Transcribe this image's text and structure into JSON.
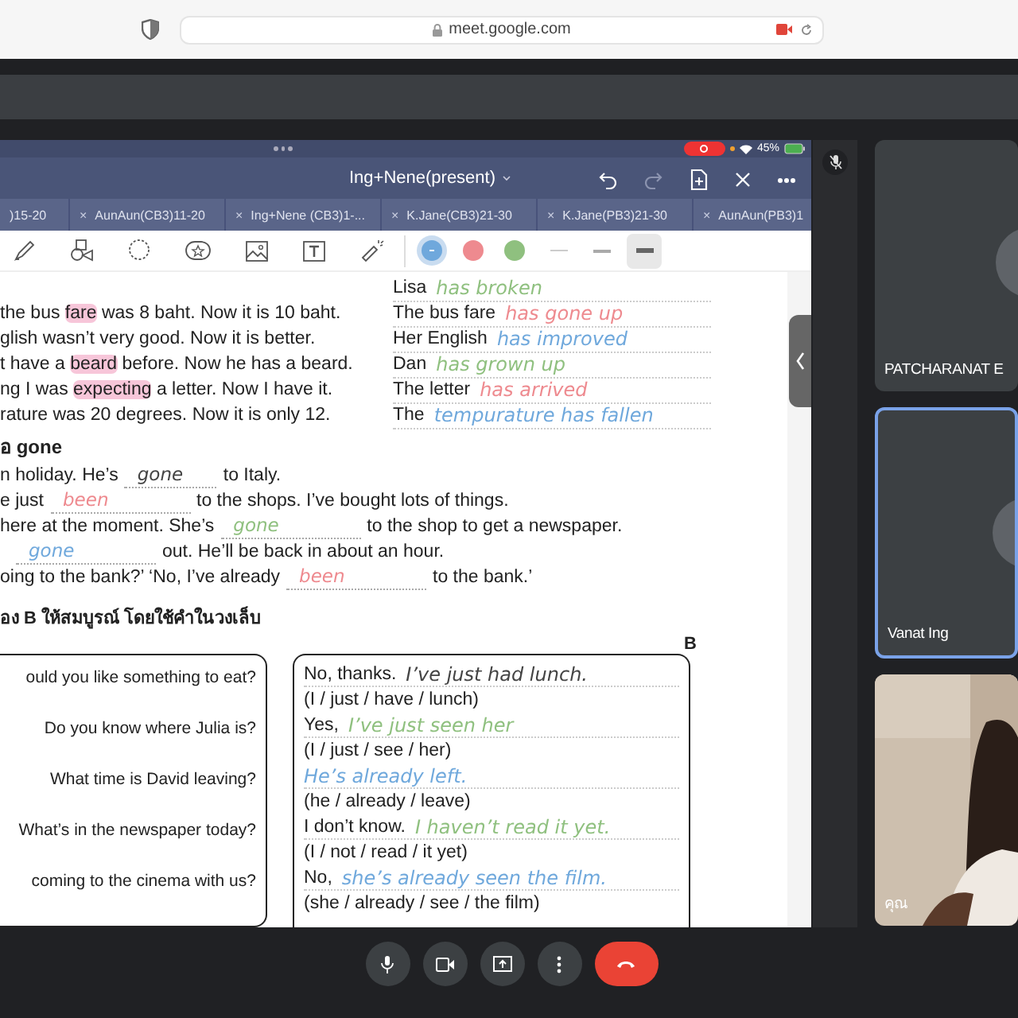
{
  "browser": {
    "url": "meet.google.com"
  },
  "presentation": {
    "battery": "45%",
    "title": "Ing+Nene(present)",
    "tabs": [
      {
        "label": ")15-20"
      },
      {
        "close": "×",
        "label": "AunAun(CB3)11-20"
      },
      {
        "close": "×",
        "label": "Ing+Nene (CB3)1-..."
      },
      {
        "close": "×",
        "label": "K.Jane(CB3)21-30"
      },
      {
        "close": "×",
        "label": "K.Jane(PB3)21-30"
      },
      {
        "close": "×",
        "label": "AunAun(PB3)1"
      }
    ],
    "pen_colors": [
      {
        "color": "#6fa8dc",
        "selected": true
      },
      {
        "color": "#ee8a8f",
        "selected": false
      },
      {
        "color": "#8fc07f",
        "selected": false
      }
    ],
    "stroke_widths": [
      {
        "selected": false
      },
      {
        "selected": false
      },
      {
        "selected": true
      }
    ],
    "worksheet": {
      "changes": [
        {
          "subject": "Lisa",
          "answer": "has broken",
          "color": "#8fc07f"
        },
        {
          "left": [
            {
              "text": "the bus ",
              "highlight": false
            },
            {
              "text": "fare",
              "highlight": true
            },
            {
              "text": " was 8 baht.  Now it is 10 baht.",
              "highlight": false
            }
          ],
          "subject": "The bus fare",
          "answer": "has gone up",
          "color": "#ee8a8f"
        },
        {
          "left": [
            {
              "text": "glish wasn’t very good.  Now it is better.",
              "highlight": false
            }
          ],
          "subject": "Her English",
          "answer": "has improved",
          "color": "#6fa8dc"
        },
        {
          "left": [
            {
              "text": "t have a ",
              "highlight": false
            },
            {
              "text": "beard",
              "highlight": true
            },
            {
              "text": " before.  Now he has a beard.",
              "highlight": false
            }
          ],
          "subject": "Dan",
          "answer": "has grown up",
          "color": "#8fc07f"
        },
        {
          "left": [
            {
              "text": "ng I was ",
              "highlight": false
            },
            {
              "text": "expecting",
              "highlight": true
            },
            {
              "text": " a letter.  Now I have it.",
              "highlight": false
            }
          ],
          "subject": "The letter",
          "answer": "has arrived",
          "color": "#ee8a8f"
        },
        {
          "left": [
            {
              "text": "rature was 20 degrees.  Now it is only 12.",
              "highlight": false
            }
          ],
          "subject": "The",
          "answer": "tempurature has fallen",
          "color": "#6fa8dc"
        }
      ],
      "gone_heading": "อ gone",
      "gone_lines": [
        {
          "before": "n holiday.  He’s",
          "fill": "gone",
          "color": "#444444",
          "after": "to Italy."
        },
        {
          "before": "e just",
          "fill": "been",
          "color": "#ee8a8f",
          "after": "to the shops.  I’ve bought lots of things."
        },
        {
          "before": "here at the moment.  She’s",
          "fill": "gone",
          "color": "#8fc07f",
          "after": "to the shop to get a newspaper."
        },
        {
          "fill": "gone",
          "color": "#6fa8dc",
          "after": "out.  He’ll be back in about an hour."
        },
        {
          "before": "oing to the bank?’  ‘No, I’ve already",
          "fill": "been",
          "color": "#ee8a8f",
          "after": "to the bank.’"
        }
      ],
      "dialog_heading": "อง B ให้สมบูรณ์ โดยใช้คำในวงเล็บ",
      "speaker_b": "B",
      "dialog": [
        {
          "question": "ould you like something to eat?",
          "prefix": "No, thanks.",
          "answer": "I’ve just had lunch.",
          "color": "#444444",
          "hint": "(I / just / have / lunch)"
        },
        {
          "question": "Do you know where Julia is?",
          "prefix": "Yes,",
          "answer": "I’ve just seen her",
          "color": "#8fc07f",
          "hint": "(I / just / see / her)"
        },
        {
          "question": "What time is David leaving?",
          "answer": "He’s already left.",
          "color": "#6fa8dc",
          "hint": "(he / already / leave)"
        },
        {
          "question": "What’s in the newspaper today?",
          "prefix": "I don’t know.",
          "answer": "I haven’t read it yet.",
          "color": "#8fc07f",
          "hint": "(I / not / read / it yet)"
        },
        {
          "question": "coming to the cinema with us?",
          "prefix": "No,",
          "answer": "she’s already seen the film.",
          "color": "#6fa8dc",
          "hint": "(she / already / see / the film)"
        }
      ]
    }
  },
  "participants": [
    {
      "name": "PATCHARANAT E",
      "kind": "avatar",
      "selected": false
    },
    {
      "name": "Vanat Ing",
      "kind": "avatar",
      "selected": true
    },
    {
      "name": "คุณ",
      "kind": "video",
      "selected": false
    }
  ]
}
